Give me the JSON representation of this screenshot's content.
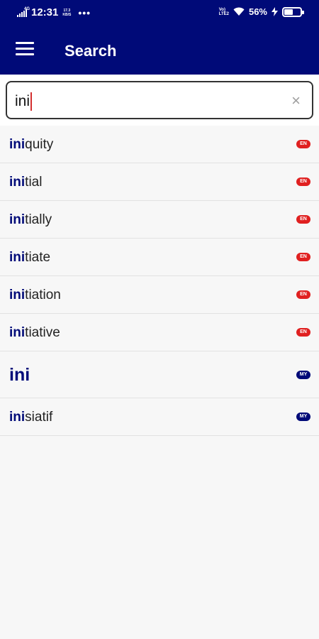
{
  "status": {
    "net": "4G",
    "time": "12:31",
    "speed_value": "17.3",
    "speed_unit": "KB/S",
    "dots": "•••",
    "volte_top": "Vo)",
    "volte_bottom": "LTE2",
    "battery_percent": "56%",
    "battery_level": 0.56
  },
  "toolbar": {
    "title": "Search"
  },
  "search": {
    "value": "ini",
    "clear_label": "×"
  },
  "results": [
    {
      "match": "ini",
      "rest": "quity",
      "lang": "EN",
      "color": "#e02020",
      "big": false
    },
    {
      "match": "ini",
      "rest": "tial",
      "lang": "EN",
      "color": "#e02020",
      "big": false
    },
    {
      "match": "ini",
      "rest": "tially",
      "lang": "EN",
      "color": "#e02020",
      "big": false
    },
    {
      "match": "ini",
      "rest": "tiate",
      "lang": "EN",
      "color": "#e02020",
      "big": false
    },
    {
      "match": "ini",
      "rest": "tiation",
      "lang": "EN",
      "color": "#e02020",
      "big": false
    },
    {
      "match": "ini",
      "rest": "tiative",
      "lang": "EN",
      "color": "#e02020",
      "big": false
    },
    {
      "match": "ini",
      "rest": "",
      "lang": "MY",
      "color": "#000a78",
      "big": true
    },
    {
      "match": "ini",
      "rest": "siatif",
      "lang": "MY",
      "color": "#000a78",
      "big": false
    }
  ]
}
